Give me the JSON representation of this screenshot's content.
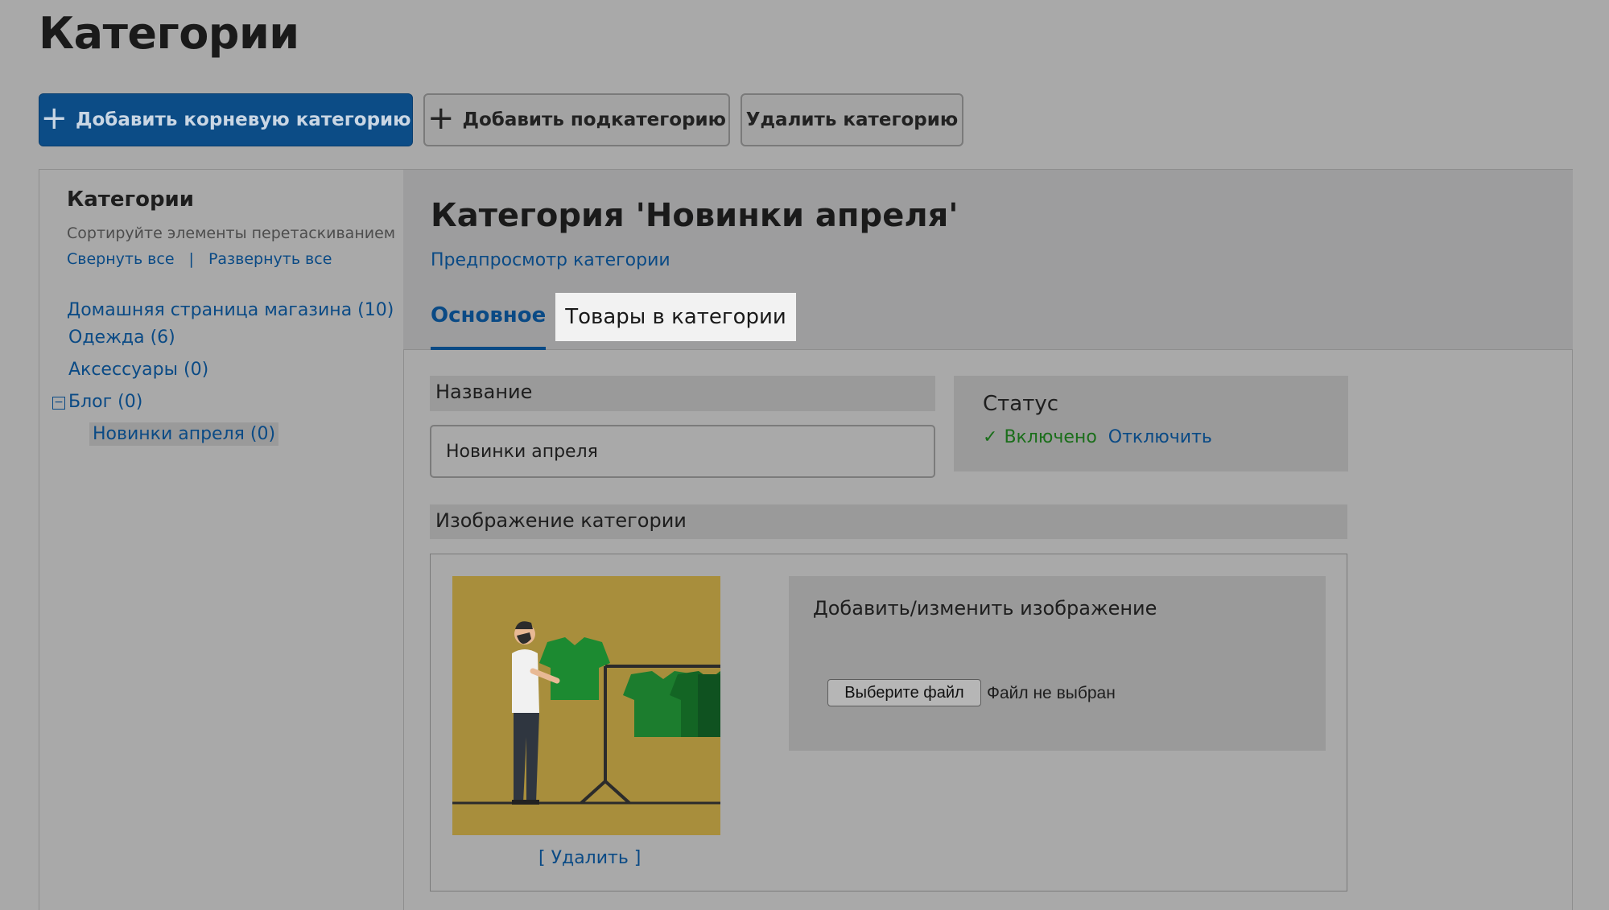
{
  "page": {
    "title": "Категории"
  },
  "toolbar": {
    "add_root_label": "Добавить корневую категорию",
    "add_sub_label": "Добавить подкатегорию",
    "delete_label": "Удалить категорию"
  },
  "sidebar": {
    "title": "Категории",
    "hint": "Сортируйте элементы перетаскиванием",
    "collapse_all": "Свернуть все",
    "separator": "|",
    "expand_all": "Развернуть все",
    "tree": [
      {
        "label": "Домашняя страница магазина (10)"
      },
      {
        "label": "Одежда (6)"
      },
      {
        "label": "Аксессуары (0)"
      },
      {
        "label": "Блог (0)",
        "collapse_symbol": "−"
      },
      {
        "label": "Новинки апреля (0)",
        "selected": true
      }
    ]
  },
  "content": {
    "title": "Категория 'Новинки апреля'",
    "preview_link": "Предпросмотр категории",
    "tabs": [
      {
        "label": "Основное",
        "active": true
      },
      {
        "label": "Товары в категории",
        "active": false
      }
    ],
    "name_label": "Название",
    "name_value": "Новинки апреля",
    "status": {
      "title": "Статус",
      "check": "✓",
      "enabled": "Включено",
      "disable": "Отключить"
    },
    "image_label": "Изображение категории",
    "remove_link": "[ Удалить ]",
    "upload": {
      "title": "Добавить/изменить изображение",
      "button": "Выберите файл",
      "status": "Файл не выбран"
    }
  },
  "colors": {
    "primary": "#0c4c86",
    "link": "#0a4a85",
    "enabled": "#1a6e1a",
    "background": "#a9a9a9"
  }
}
